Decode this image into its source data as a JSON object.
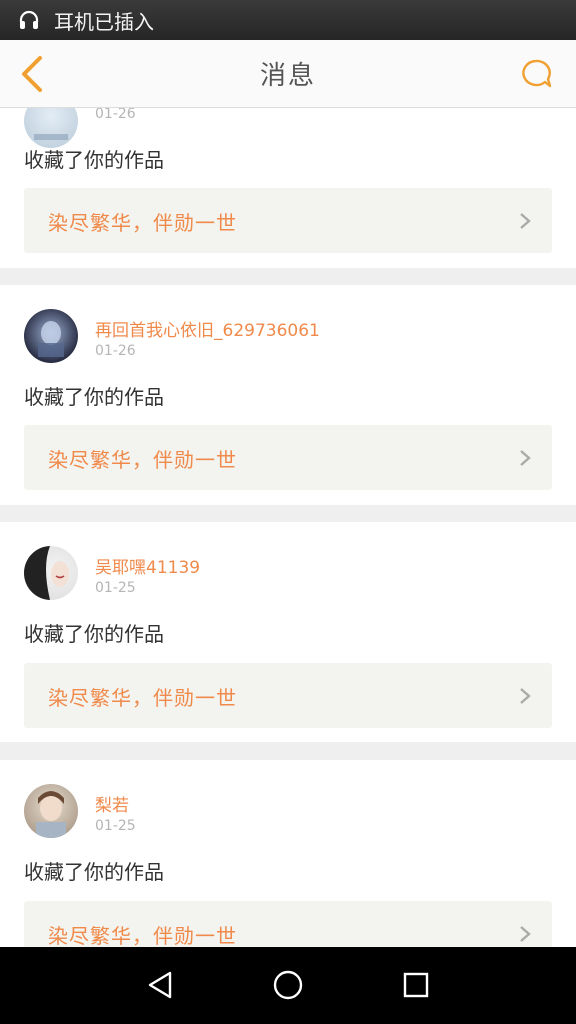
{
  "status_bar": {
    "icon": "headphones-icon",
    "text": "耳机已插入"
  },
  "header": {
    "title": "消息",
    "back_icon": "chevron-left-icon",
    "chat_icon": "chat-bubble-icon",
    "accent": "#f0a030"
  },
  "messages": [
    {
      "username": "",
      "date": "01-26",
      "action": "收藏了你的作品",
      "work_title": "染尽繁华，伴勋一世"
    },
    {
      "username": "再回首我心依旧_629736061",
      "date": "01-26",
      "action": "收藏了你的作品",
      "work_title": "染尽繁华，伴勋一世"
    },
    {
      "username": "吴耶嘿41139",
      "date": "01-25",
      "action": "收藏了你的作品",
      "work_title": "染尽繁华，伴勋一世"
    },
    {
      "username": "梨若",
      "date": "01-25",
      "action": "收藏了你的作品",
      "work_title": "染尽繁华，伴勋一世"
    }
  ],
  "colors": {
    "username": "#f08a4b",
    "date": "#b5b5b5",
    "work_bg": "#f3f3ef",
    "feed_gap": "#efefef"
  },
  "nav_bar": {
    "back": "triangle-back-icon",
    "home": "circle-home-icon",
    "recents": "square-recents-icon"
  }
}
